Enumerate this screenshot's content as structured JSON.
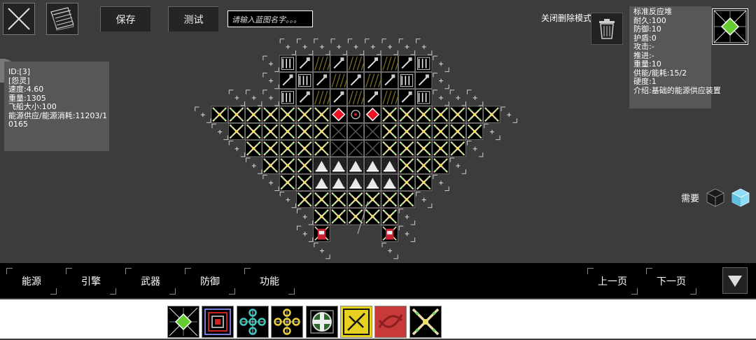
{
  "toolbar": {
    "save_label": "保存",
    "test_label": "测试",
    "name_placeholder": "请输入蓝图名字。。。"
  },
  "delete_mode_label": "关闭删除模式",
  "ship_info": {
    "lines": [
      "ID:[3]",
      "[怨灵]",
      "速度:4.60",
      "重量:1305",
      "飞船大小:100",
      "能源供应/能源消耗:11203/1",
      "0165"
    ]
  },
  "part_info": {
    "lines": [
      "标准反应堆",
      "耐久:100",
      "防御:10",
      "护盾:0",
      "攻击:-",
      "推进:-",
      "重量:10",
      "供能/能耗:15/2",
      "硬度:1",
      "介绍:基础的能源供应装置"
    ]
  },
  "requirement_label": "需要",
  "categories": [
    "能源",
    "引擎",
    "武器",
    "防御",
    "功能"
  ],
  "pager": {
    "prev_label": "上一页",
    "next_label": "下一页"
  },
  "palette_parts": [
    "reactor-part",
    "red-core-part",
    "teal-node-part",
    "yellow-node-part",
    "green-cross-part",
    "yellow-x-part",
    "red-swirl-part",
    "cross-reactor-part"
  ],
  "colors": {
    "background": "#3c3c3c",
    "panel": "#575757",
    "accent_green": "#66cc33",
    "cube_blue": "#7fd6f2"
  }
}
